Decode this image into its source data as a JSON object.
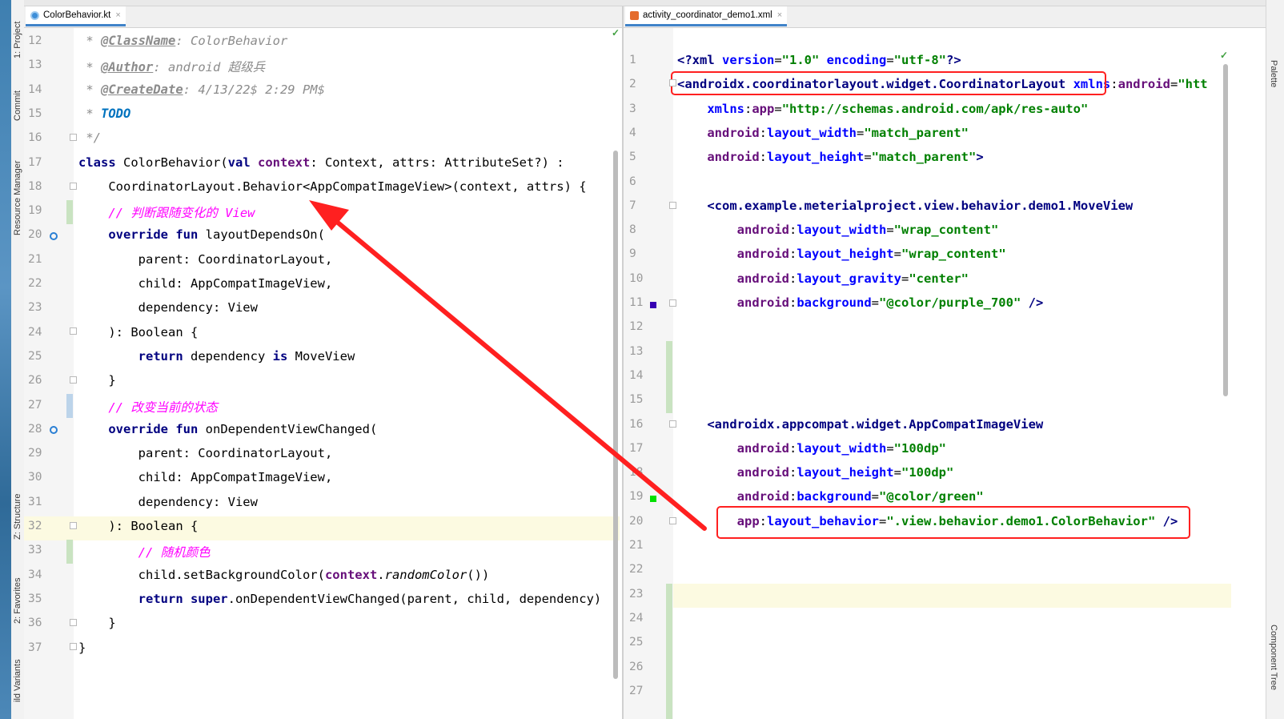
{
  "tool_windows": {
    "left": [
      "1: Project",
      "Commit",
      "Resource Manager",
      "Z: Structure",
      "2: Favorites",
      "ild Variants"
    ],
    "right": [
      "Palette",
      "Component Tree"
    ]
  },
  "left_tab": {
    "label": "ColorBehavior.kt",
    "close": "×"
  },
  "right_tab": {
    "label": "activity_coordinator_demo1.xml",
    "close": "×"
  },
  "left_editor": {
    "line_numbers": [
      "12",
      "13",
      "14",
      "15",
      "16",
      "17",
      "18",
      "19",
      "20",
      "21",
      "22",
      "23",
      "24",
      "25",
      "26",
      "27",
      "28",
      "29",
      "30",
      "31",
      "32",
      "33",
      "34",
      "35",
      "36",
      "37"
    ],
    "lines": [
      [
        {
          "t": " * ",
          "c": "cmt"
        },
        {
          "t": "@ClassName",
          "c": "ctag"
        },
        {
          "t": ": ColorBehavior",
          "c": "cmt"
        }
      ],
      [
        {
          "t": " * ",
          "c": "cmt"
        },
        {
          "t": "@Author",
          "c": "ctag"
        },
        {
          "t": ": android 超级兵",
          "c": "cmt"
        }
      ],
      [
        {
          "t": " * ",
          "c": "cmt"
        },
        {
          "t": "@CreateDate",
          "c": "ctag"
        },
        {
          "t": ": 4/13/22$ 2:29 PM$",
          "c": "cmt"
        }
      ],
      [
        {
          "t": " * ",
          "c": "cmt"
        },
        {
          "t": "TODO",
          "c": "todo"
        }
      ],
      [
        {
          "t": " */",
          "c": "cmt"
        }
      ],
      [
        {
          "t": "class ",
          "c": "kw"
        },
        {
          "t": "ColorBehavior(",
          "c": ""
        },
        {
          "t": "val ",
          "c": "kw"
        },
        {
          "t": "context",
          "c": "ctx"
        },
        {
          "t": ": Context, attrs: AttributeSet?) :",
          "c": ""
        }
      ],
      [
        {
          "t": "    CoordinatorLayout.Behavior<AppCompatImageView>(context, attrs) {",
          "c": ""
        }
      ],
      [
        {
          "t": "    // 判断跟随变化的 View",
          "c": "pink"
        }
      ],
      [
        {
          "t": "    ",
          "c": ""
        },
        {
          "t": "override fun ",
          "c": "kw"
        },
        {
          "t": "layoutDependsOn(",
          "c": ""
        }
      ],
      [
        {
          "t": "        parent: CoordinatorLayout,",
          "c": ""
        }
      ],
      [
        {
          "t": "        child: AppCompatImageView,",
          "c": ""
        }
      ],
      [
        {
          "t": "        dependency: View",
          "c": ""
        }
      ],
      [
        {
          "t": "    ): Boolean {",
          "c": ""
        }
      ],
      [
        {
          "t": "        ",
          "c": ""
        },
        {
          "t": "return ",
          "c": "kw"
        },
        {
          "t": "dependency ",
          "c": ""
        },
        {
          "t": "is ",
          "c": "kw"
        },
        {
          "t": "MoveView",
          "c": ""
        }
      ],
      [
        {
          "t": "    }",
          "c": ""
        }
      ],
      [
        {
          "t": "    // 改变当前的状态",
          "c": "pink"
        }
      ],
      [
        {
          "t": "    ",
          "c": ""
        },
        {
          "t": "override fun ",
          "c": "kw"
        },
        {
          "t": "onDependentViewChanged(",
          "c": ""
        }
      ],
      [
        {
          "t": "        parent: CoordinatorLayout,",
          "c": ""
        }
      ],
      [
        {
          "t": "        child: AppCompatImageView,",
          "c": ""
        }
      ],
      [
        {
          "t": "        dependency: View",
          "c": ""
        }
      ],
      [
        {
          "t": "    ): Boolean {",
          "c": ""
        }
      ],
      [
        {
          "t": "        // 随机颜色",
          "c": "pink"
        }
      ],
      [
        {
          "t": "        child.setBackgroundColor(",
          "c": ""
        },
        {
          "t": "context",
          "c": "ctx"
        },
        {
          "t": ".",
          "c": ""
        },
        {
          "t": "randomColor",
          "c": "it"
        },
        {
          "t": "())",
          "c": ""
        }
      ],
      [
        {
          "t": "        ",
          "c": ""
        },
        {
          "t": "return super",
          "c": "kw"
        },
        {
          "t": ".onDependentViewChanged(parent, child, dependency)",
          "c": ""
        }
      ],
      [
        {
          "t": "    }",
          "c": ""
        }
      ],
      [
        {
          "t": "}",
          "c": ""
        }
      ]
    ]
  },
  "right_editor": {
    "line_numbers": [
      "1",
      "2",
      "3",
      "4",
      "5",
      "6",
      "7",
      "8",
      "9",
      "10",
      "11",
      "12",
      "13",
      "14",
      "15",
      "16",
      "17",
      "18",
      "19",
      "20",
      "21",
      "22",
      "23",
      "24",
      "25",
      "26",
      "27"
    ],
    "lines": [
      [
        {
          "t": "<?",
          "c": "xpi"
        },
        {
          "t": "xml ",
          "c": "xpi"
        },
        {
          "t": "version",
          "c": "xpiattr"
        },
        {
          "t": "=",
          "c": ""
        },
        {
          "t": "\"1.0\" ",
          "c": "xval"
        },
        {
          "t": "encoding",
          "c": "xpiattr"
        },
        {
          "t": "=",
          "c": ""
        },
        {
          "t": "\"utf-8\"",
          "c": "xval"
        },
        {
          "t": "?>",
          "c": "xpi"
        }
      ],
      [
        {
          "t": "<androidx.coordinatorlayout.widget.CoordinatorLayout ",
          "c": "xtag"
        },
        {
          "t": "xmlns",
          "c": "xns"
        },
        {
          "t": ":",
          "c": ""
        },
        {
          "t": "android",
          "c": "xattr"
        },
        {
          "t": "=",
          "c": ""
        },
        {
          "t": "\"htt",
          "c": "xval"
        }
      ],
      [
        {
          "t": "    ",
          "c": ""
        },
        {
          "t": "xmlns",
          "c": "xns"
        },
        {
          "t": ":",
          "c": ""
        },
        {
          "t": "app",
          "c": "xattr"
        },
        {
          "t": "=",
          "c": ""
        },
        {
          "t": "\"http://schemas.android.com/apk/res-auto\"",
          "c": "xval"
        }
      ],
      [
        {
          "t": "    ",
          "c": ""
        },
        {
          "t": "android",
          "c": "xattr"
        },
        {
          "t": ":",
          "c": ""
        },
        {
          "t": "layout_width",
          "c": "xns"
        },
        {
          "t": "=",
          "c": ""
        },
        {
          "t": "\"match_parent\"",
          "c": "xval"
        }
      ],
      [
        {
          "t": "    ",
          "c": ""
        },
        {
          "t": "android",
          "c": "xattr"
        },
        {
          "t": ":",
          "c": ""
        },
        {
          "t": "layout_height",
          "c": "xns"
        },
        {
          "t": "=",
          "c": ""
        },
        {
          "t": "\"match_parent\"",
          "c": "xval"
        },
        {
          "t": ">",
          "c": "xtag"
        }
      ],
      [],
      [
        {
          "t": "    <com.example.meterialproject.view.behavior.demo1.MoveView",
          "c": "xtag"
        }
      ],
      [
        {
          "t": "        ",
          "c": ""
        },
        {
          "t": "android",
          "c": "xattr"
        },
        {
          "t": ":",
          "c": ""
        },
        {
          "t": "layout_width",
          "c": "xns"
        },
        {
          "t": "=",
          "c": ""
        },
        {
          "t": "\"wrap_content\"",
          "c": "xval"
        }
      ],
      [
        {
          "t": "        ",
          "c": ""
        },
        {
          "t": "android",
          "c": "xattr"
        },
        {
          "t": ":",
          "c": ""
        },
        {
          "t": "layout_height",
          "c": "xns"
        },
        {
          "t": "=",
          "c": ""
        },
        {
          "t": "\"wrap_content\"",
          "c": "xval"
        }
      ],
      [
        {
          "t": "        ",
          "c": ""
        },
        {
          "t": "android",
          "c": "xattr"
        },
        {
          "t": ":",
          "c": ""
        },
        {
          "t": "layout_gravity",
          "c": "xns"
        },
        {
          "t": "=",
          "c": ""
        },
        {
          "t": "\"center\"",
          "c": "xval"
        }
      ],
      [
        {
          "t": "        ",
          "c": ""
        },
        {
          "t": "android",
          "c": "xattr"
        },
        {
          "t": ":",
          "c": ""
        },
        {
          "t": "background",
          "c": "xns"
        },
        {
          "t": "=",
          "c": ""
        },
        {
          "t": "\"@color/purple_700\" ",
          "c": "xval"
        },
        {
          "t": "/>",
          "c": "xtag"
        }
      ],
      [],
      [],
      [],
      [],
      [
        {
          "t": "    <androidx.appcompat.widget.AppCompatImageView",
          "c": "xtag"
        }
      ],
      [
        {
          "t": "        ",
          "c": ""
        },
        {
          "t": "android",
          "c": "xattr"
        },
        {
          "t": ":",
          "c": ""
        },
        {
          "t": "layout_width",
          "c": "xns"
        },
        {
          "t": "=",
          "c": ""
        },
        {
          "t": "\"100dp\"",
          "c": "xval"
        }
      ],
      [
        {
          "t": "        ",
          "c": ""
        },
        {
          "t": "android",
          "c": "xattr"
        },
        {
          "t": ":",
          "c": ""
        },
        {
          "t": "layout_height",
          "c": "xns"
        },
        {
          "t": "=",
          "c": ""
        },
        {
          "t": "\"100dp\"",
          "c": "xval"
        }
      ],
      [
        {
          "t": "        ",
          "c": ""
        },
        {
          "t": "android",
          "c": "xattr"
        },
        {
          "t": ":",
          "c": ""
        },
        {
          "t": "background",
          "c": "xns"
        },
        {
          "t": "=",
          "c": ""
        },
        {
          "t": "\"@color/green\"",
          "c": "xval"
        }
      ],
      [
        {
          "t": "        ",
          "c": ""
        },
        {
          "t": "app",
          "c": "xattr"
        },
        {
          "t": ":",
          "c": ""
        },
        {
          "t": "layout_behavior",
          "c": "xns"
        },
        {
          "t": "=",
          "c": ""
        },
        {
          "t": "\".view.behavior.demo1.ColorBehavior\" ",
          "c": "xval"
        },
        {
          "t": "/>",
          "c": "xtag"
        }
      ],
      [],
      [],
      [],
      [],
      [],
      [],
      []
    ]
  },
  "colors": {
    "annotation_red": "#ff2020",
    "caret_line": "#fcfae1",
    "vcs_added": "#c9e3c1",
    "vcs_modified": "#bcd4ea"
  }
}
